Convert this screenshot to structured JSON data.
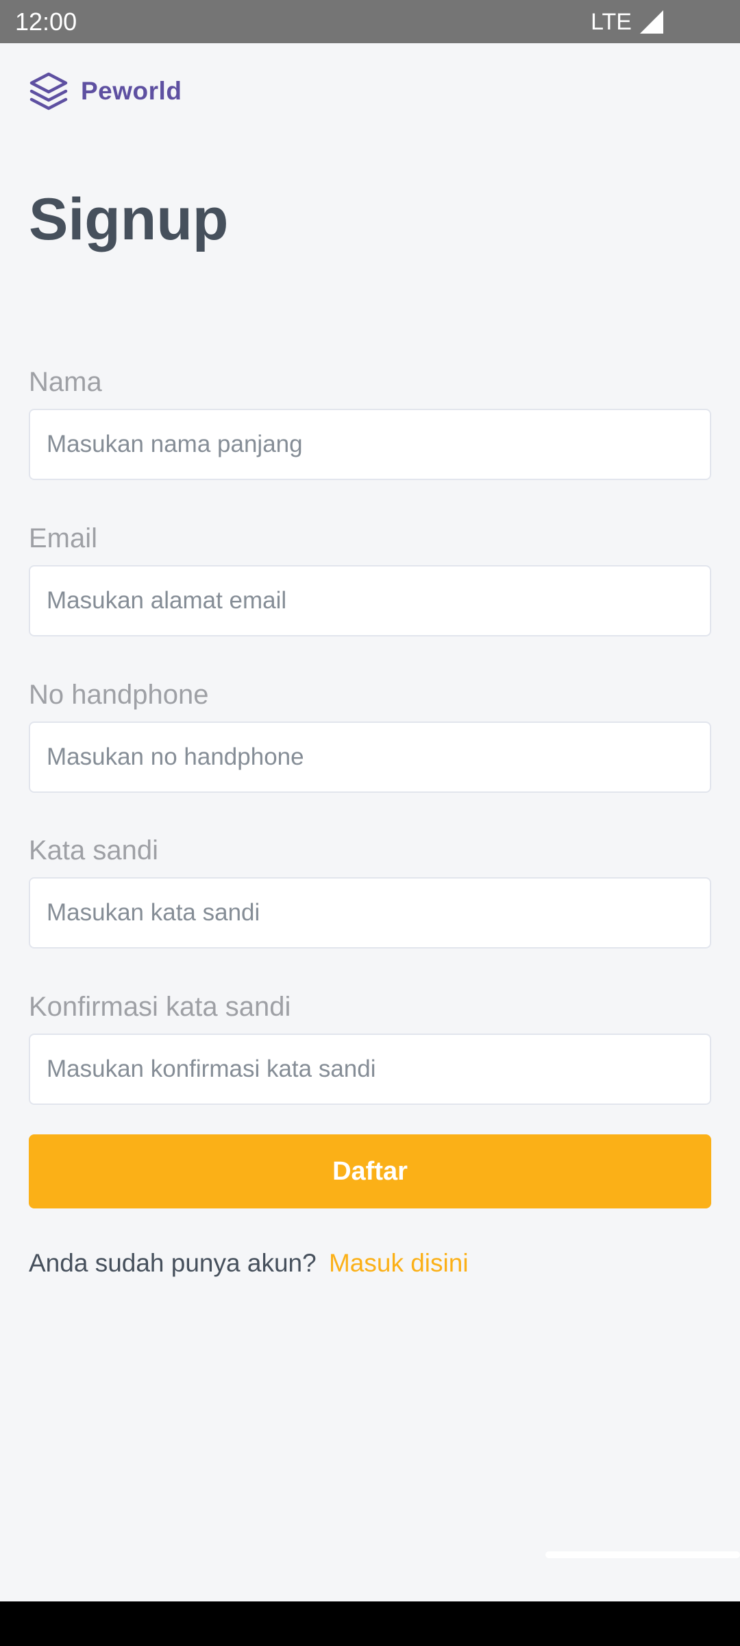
{
  "status_bar": {
    "time": "12:00",
    "network": "LTE",
    "signal_icon": "cellular-signal-icon"
  },
  "brand": {
    "name": "Peworld",
    "icon": "layers-icon",
    "color": "#5e50a1"
  },
  "page": {
    "title": "Signup"
  },
  "form": {
    "fields": [
      {
        "label": "Nama",
        "placeholder": "Masukan nama panjang",
        "value": ""
      },
      {
        "label": "Email",
        "placeholder": "Masukan alamat email",
        "value": ""
      },
      {
        "label": "No handphone",
        "placeholder": "Masukan no handphone",
        "value": ""
      },
      {
        "label": "Kata sandi",
        "placeholder": "Masukan kata sandi",
        "value": ""
      },
      {
        "label": "Konfirmasi kata sandi",
        "placeholder": "Masukan konfirmasi kata sandi",
        "value": ""
      }
    ],
    "submit_label": "Daftar",
    "accent_color": "#fbb017"
  },
  "footer": {
    "prompt": "Anda sudah punya akun?",
    "link": "Masuk disini"
  }
}
